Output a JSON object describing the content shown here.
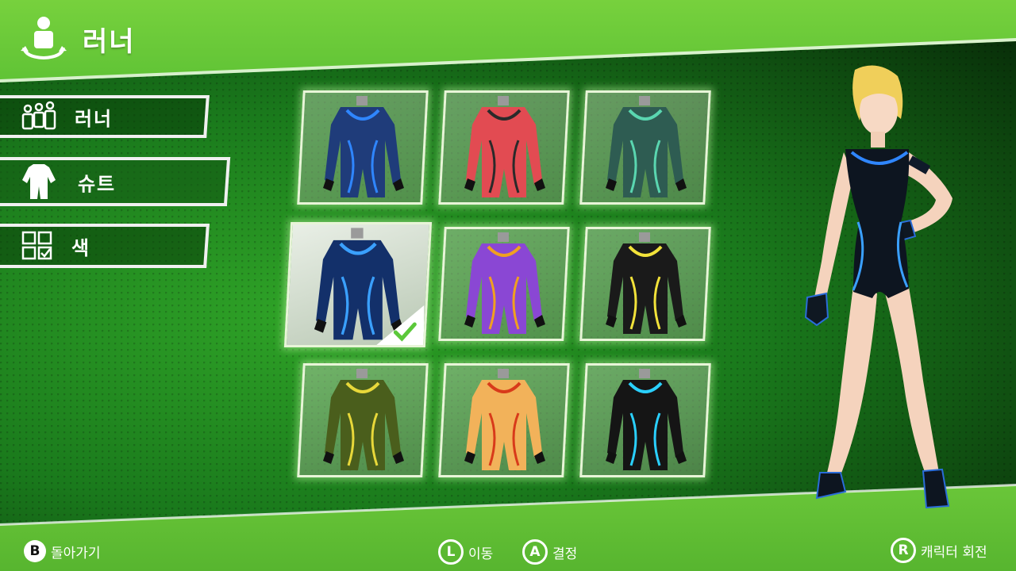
{
  "header": {
    "title": "러너",
    "icon": "runner-rotate-icon"
  },
  "menu": {
    "items": [
      {
        "label": "러너",
        "icon": "runners-icon",
        "selected": false
      },
      {
        "label": "슈트",
        "icon": "suit-icon",
        "selected": true
      },
      {
        "label": "색",
        "icon": "color-grid-icon",
        "selected": false
      }
    ]
  },
  "suits": [
    {
      "color": "#1f3c7a",
      "accent": "#2f86ff",
      "selected": false
    },
    {
      "color": "#e24b52",
      "accent": "#2a2a2a",
      "selected": false
    },
    {
      "color": "#2e5c52",
      "accent": "#5ad6b0",
      "selected": false
    },
    {
      "color": "#13306a",
      "accent": "#3aa0ff",
      "selected": true
    },
    {
      "color": "#8a47d4",
      "accent": "#f0a020",
      "selected": false
    },
    {
      "color": "#1a1a1a",
      "accent": "#f2e23a",
      "selected": false
    },
    {
      "color": "#4a5e1c",
      "accent": "#e8d83a",
      "selected": false
    },
    {
      "color": "#f2b25a",
      "accent": "#d83a1a",
      "selected": false
    },
    {
      "color": "#151515",
      "accent": "#2ad0ff",
      "selected": false
    }
  ],
  "footer": {
    "back": {
      "key": "B",
      "label": "돌아가기"
    },
    "move": {
      "key": "L",
      "label": "이동"
    },
    "confirm": {
      "key": "A",
      "label": "결정"
    },
    "rotate": {
      "key": "R",
      "label": "캐릭터 회전"
    }
  }
}
